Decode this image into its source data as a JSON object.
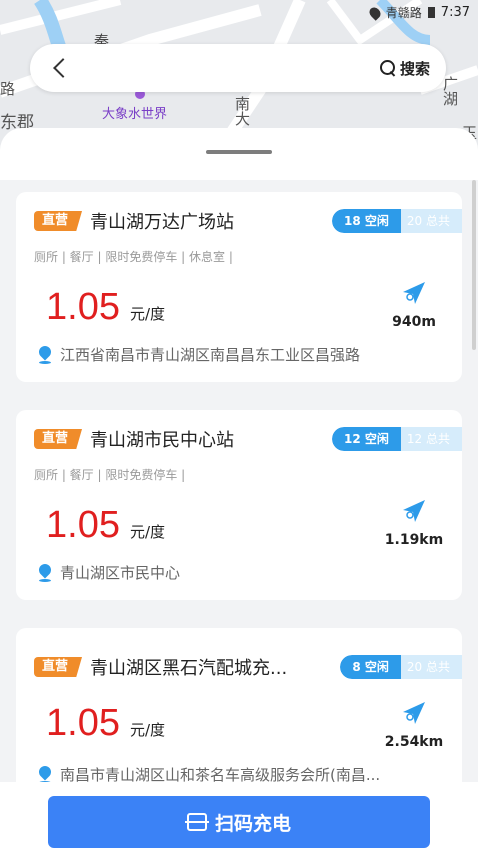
{
  "status": {
    "time": "7:37",
    "road": "青赣路"
  },
  "map": {
    "labels": {
      "top_char": "秦",
      "lu": "路",
      "dongjun": "东郡",
      "water_world": "大象水世界",
      "nan_da": "南大",
      "guang_hu": "广湖",
      "yu": "玉"
    }
  },
  "search": {
    "label": "搜索"
  },
  "stations": [
    {
      "tag": "直营",
      "name": "青山湖万达广场站",
      "free": "18 空闲",
      "total": "20 总共",
      "facilities": "厕所 | 餐厅 | 限时免费停车 | 休息室 |",
      "price": "1.05",
      "unit": "元/度",
      "distance": "940m",
      "address": "江西省南昌市青山湖区南昌昌东工业区昌强路"
    },
    {
      "tag": "直营",
      "name": "青山湖市民中心站",
      "free": "12 空闲",
      "total": "12 总共",
      "facilities": "厕所 | 餐厅 | 限时免费停车 |",
      "price": "1.05",
      "unit": "元/度",
      "distance": "1.19km",
      "address": "青山湖区市民中心"
    },
    {
      "tag": "直营",
      "name": "青山湖区黑石汽配城充...",
      "free": "8 空闲",
      "total": "20 总共",
      "facilities": "",
      "price": "1.05",
      "unit": "元/度",
      "distance": "2.54km",
      "address": "南昌市青山湖区山和茶名车高级服务会所(南昌..."
    }
  ],
  "action": {
    "scan_label": "扫码充电"
  },
  "colors": {
    "accent": "#3b82f6",
    "price": "#e01f1f",
    "tag": "#f08c2a",
    "free": "#2d9be9"
  }
}
